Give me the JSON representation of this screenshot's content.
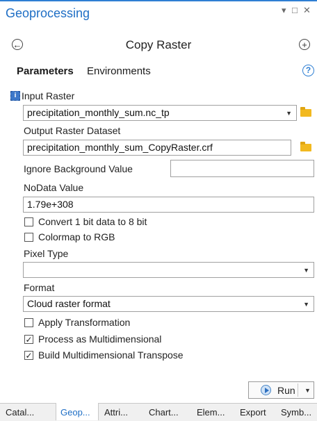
{
  "pane": {
    "title": "Geoprocessing",
    "controls": [
      "▾",
      "□",
      "✕"
    ]
  },
  "tool": {
    "title": "Copy Raster",
    "back_icon": "back-arrow-icon",
    "add_icon": "add-icon"
  },
  "tabs": {
    "parameters": "Parameters",
    "environments": "Environments",
    "help": "?"
  },
  "params": {
    "input_raster_label": "Input Raster",
    "input_raster_value": "precipitation_monthly_sum.nc_tp",
    "output_raster_label": "Output Raster Dataset",
    "output_raster_value": "precipitation_monthly_sum_CopyRaster.crf",
    "ignore_bg_label": "Ignore Background Value",
    "ignore_bg_value": "",
    "nodata_label": "NoData Value",
    "nodata_value": "1.79e+308",
    "convert_1bit_label": "Convert 1 bit data to 8 bit",
    "convert_1bit_checked": false,
    "colormap_label": "Colormap to RGB",
    "colormap_checked": false,
    "pixel_type_label": "Pixel Type",
    "pixel_type_value": "",
    "format_label": "Format",
    "format_value": "Cloud raster format",
    "apply_transform_label": "Apply Transformation",
    "apply_transform_checked": false,
    "process_multi_label": "Process as Multidimensional",
    "process_multi_checked": true,
    "build_transpose_label": "Build Multidimensional Transpose",
    "build_transpose_checked": true
  },
  "run": {
    "label": "Run"
  },
  "bottom_tabs": [
    "Catal...",
    "Geop...",
    "Attri...",
    "Chart...",
    "Elem...",
    "Export",
    "Symb..."
  ],
  "colors": {
    "accent": "#1e6ec5",
    "folder": "#f2b91f"
  }
}
